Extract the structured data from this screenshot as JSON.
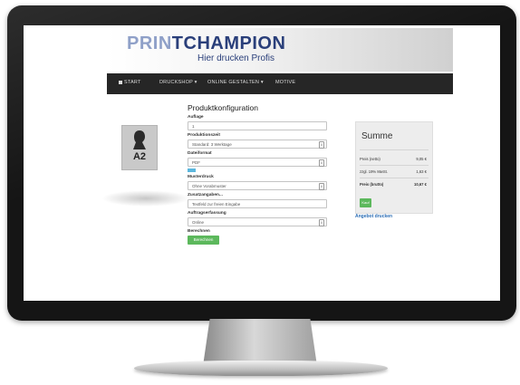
{
  "header": {
    "logo_light": "PRIN",
    "logo_bold": "TCHAMPION",
    "tagline": "Hier drucken Profis"
  },
  "nav": {
    "items": [
      {
        "label": "START"
      },
      {
        "label": "DRUCKSHOP ▾"
      },
      {
        "label": "ONLINE GESTALTEN ▾"
      },
      {
        "label": "MOTIVE"
      }
    ]
  },
  "product": {
    "size_label": "A2"
  },
  "form": {
    "title": "Produktkonfiguration",
    "auflage_label": "Auflage",
    "auflage_value": "1",
    "produktionszeit_label": "Produktionszeit",
    "produktionszeit_value": "Standard: 3 Werktage",
    "dateiformat_label": "Dateiformat",
    "dateiformat_value": "PDF",
    "musterdruck_label": "Musterdruck",
    "musterdruck_value": "Ohne Vorabmuster",
    "zusatzangaben_label": "Zusatzangaben...",
    "zusatzangaben_placeholder": "Textfeld zur freien Eingabe",
    "auftragserfassung_label": "Auftragserfassung",
    "auftragserfassung_value": "Online",
    "berechnen_label": "Berechnen",
    "berechnen_button": "Berechnen"
  },
  "summary": {
    "title": "Summe",
    "rows": [
      {
        "label": "Preis (netto)",
        "value": "9,05 €"
      },
      {
        "label": "zzgl. 19% MwSt.",
        "value": "1,63 €"
      },
      {
        "label": "Preis (brutto)",
        "value": "10,67 €"
      }
    ],
    "buy_button": "Kauf",
    "offer_link": "Angebot drucken"
  },
  "colors": {
    "brand": "#2a3f7a",
    "navbar": "#262626",
    "success": "#5cb85c",
    "link": "#2a6db5"
  }
}
